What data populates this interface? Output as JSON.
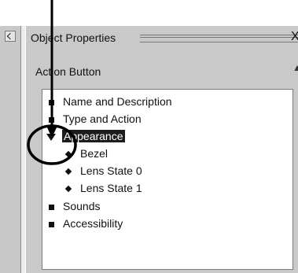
{
  "panel": {
    "title": "Object Properties",
    "close_glyph": "X",
    "group_header": "Action Button",
    "scroll_up_glyph": "▲",
    "dock_icon": "chevron-left-icon"
  },
  "tree": {
    "items": [
      {
        "label": "Name and Description",
        "icon": "square-bullet-icon",
        "level": 0
      },
      {
        "label": "Type and Action",
        "icon": "square-bullet-icon",
        "level": 0
      },
      {
        "label": "Appearance",
        "icon": "expanded-triangle-icon",
        "level": 0,
        "selected": true
      },
      {
        "label": "Bezel",
        "icon": "diamond-bullet-icon",
        "level": 1
      },
      {
        "label": "Lens State 0",
        "icon": "diamond-bullet-icon",
        "level": 1
      },
      {
        "label": "Lens State 1",
        "icon": "diamond-bullet-icon",
        "level": 1
      },
      {
        "label": "Sounds",
        "icon": "square-bullet-icon",
        "level": 0
      },
      {
        "label": "Accessibility",
        "icon": "square-bullet-icon",
        "level": 0
      }
    ]
  },
  "annotation": {
    "shapes": [
      "arrow",
      "circle"
    ],
    "color": "#000000"
  }
}
